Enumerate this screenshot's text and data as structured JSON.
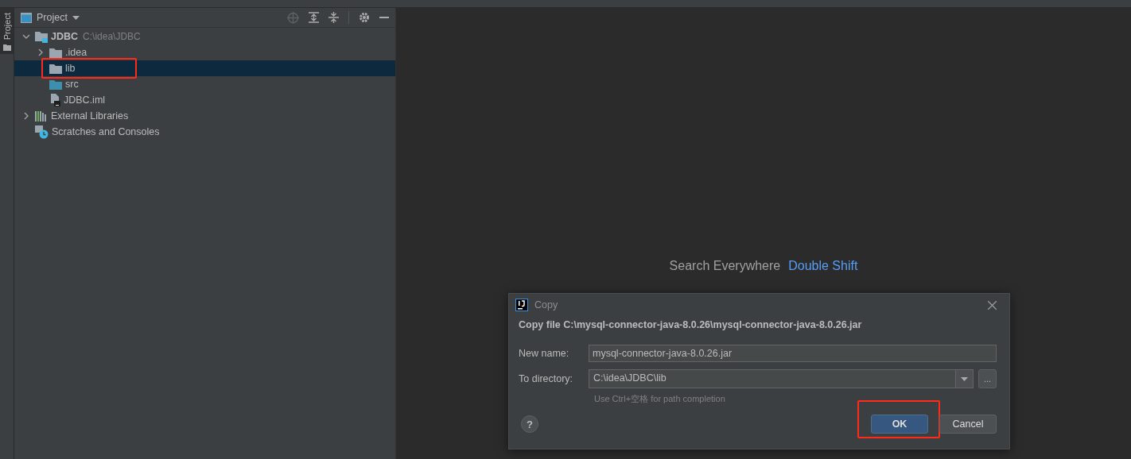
{
  "tool_strip": {
    "tab": {
      "label": "Project",
      "selected": true
    }
  },
  "project_panel": {
    "title": "Project",
    "tree": [
      {
        "kind": "module",
        "name": "JDBC",
        "path": "C:\\idea\\JDBC",
        "expanded": true,
        "selected": false,
        "highlighted": false,
        "children": [
          {
            "kind": "folder",
            "name": ".idea",
            "expanded": false,
            "selected": false,
            "highlighted": false
          },
          {
            "kind": "folder",
            "name": "lib",
            "selected": true,
            "highlighted": true
          },
          {
            "kind": "source",
            "name": "src",
            "selected": false,
            "highlighted": false
          },
          {
            "kind": "file",
            "name": "JDBC.iml",
            "selected": false,
            "highlighted": false
          }
        ]
      },
      {
        "kind": "libraries",
        "name": "External Libraries",
        "expanded": false,
        "selected": false,
        "highlighted": false
      },
      {
        "kind": "scratches",
        "name": "Scratches and Consoles",
        "selected": false,
        "highlighted": false
      }
    ]
  },
  "editor": {
    "hint": {
      "label": "Search Everywhere",
      "shortcut": "Double Shift"
    }
  },
  "dialog": {
    "title": "Copy",
    "message": "Copy file C:\\mysql-connector-java-8.0.26\\mysql-connector-java-8.0.26.jar",
    "new_name": {
      "label": "New name:",
      "value": "mysql-connector-java-8.0.26.jar"
    },
    "to_directory": {
      "label": "To directory:",
      "value": "C:\\idea\\JDBC\\lib",
      "browse": "...",
      "note": "Use Ctrl+空格 for path completion"
    },
    "help": "?",
    "buttons": [
      {
        "label": "OK",
        "default": true,
        "highlighted": true
      },
      {
        "label": "Cancel",
        "default": false,
        "highlighted": false
      }
    ]
  }
}
